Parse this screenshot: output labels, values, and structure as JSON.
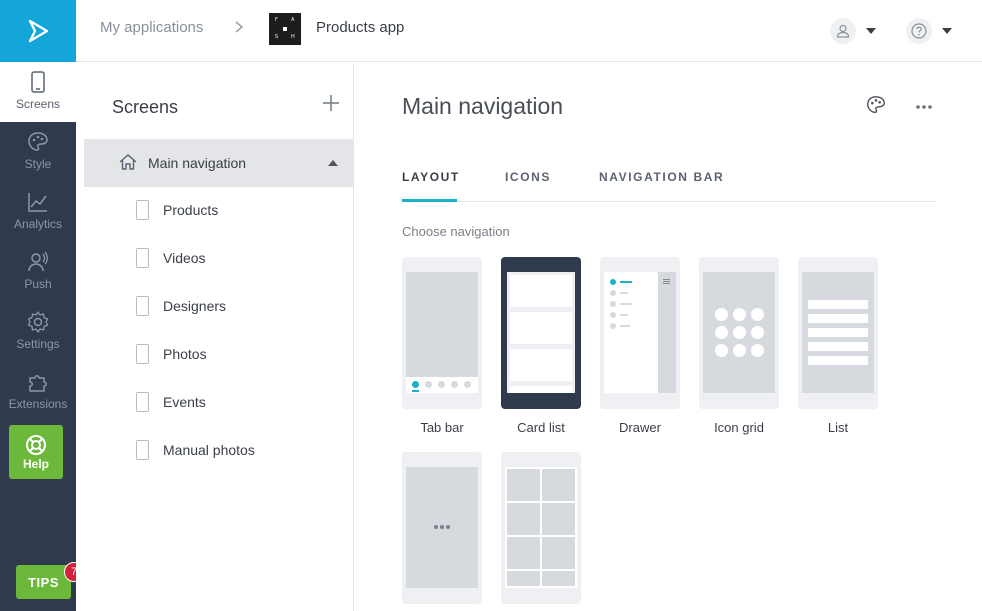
{
  "rail": {
    "items": [
      {
        "label": "Screens",
        "icon": "phone-icon"
      },
      {
        "label": "Style",
        "icon": "palette-icon"
      },
      {
        "label": "Analytics",
        "icon": "analytics-icon"
      },
      {
        "label": "Push",
        "icon": "push-icon"
      },
      {
        "label": "Settings",
        "icon": "gear-icon"
      },
      {
        "label": "Extensions",
        "icon": "puzzle-icon"
      }
    ],
    "help_label": "Help",
    "tips_label": "TIPS",
    "tips_count": "7"
  },
  "topbar": {
    "breadcrumb_root": "My applications",
    "app_name": "Products app",
    "app_logo_letters": [
      "F",
      "A",
      "S",
      "H"
    ]
  },
  "screens": {
    "title": "Screens",
    "selected": "Main navigation",
    "items": [
      "Products",
      "Videos",
      "Designers",
      "Photos",
      "Events",
      "Manual photos"
    ]
  },
  "main": {
    "title": "Main navigation",
    "tabs": [
      "LAYOUT",
      "ICONS",
      "NAVIGATION BAR"
    ],
    "active_tab": "LAYOUT",
    "choose_label": "Choose navigation",
    "options": [
      "Tab bar",
      "Card list",
      "Drawer",
      "Icon grid",
      "List"
    ],
    "selected_option": "Card list"
  },
  "colors": {
    "accent": "#1ab1c9",
    "rail_bg": "#2f3a4c",
    "logo_bg": "#14a5d9",
    "help_green": "#6cb83a",
    "badge_red": "#d2203a"
  }
}
